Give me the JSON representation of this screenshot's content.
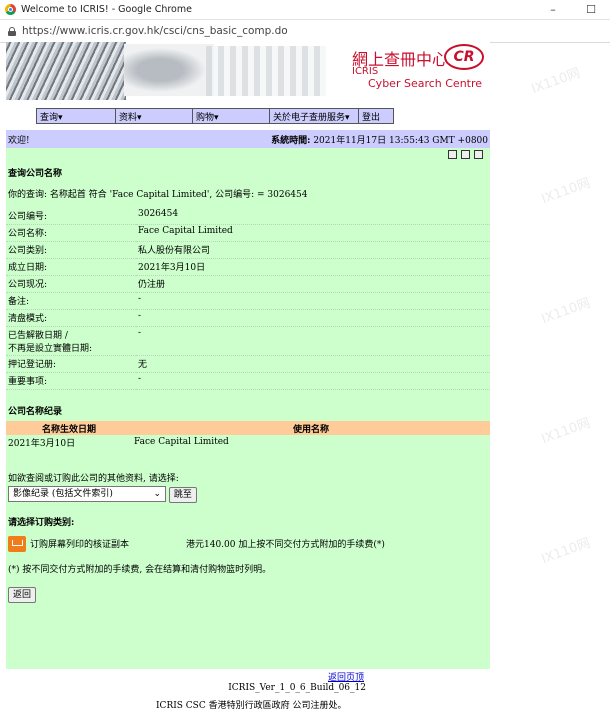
{
  "window": {
    "title": "Welcome to ICRIS! - Google Chrome",
    "url": "https://www.icris.cr.gov.hk/csci/cns_basic_comp.do",
    "min": "–",
    "max": "☐"
  },
  "banner": {
    "cn_title": "網上查冊中心",
    "logo": "CR",
    "icris": "ICRIS",
    "csc": "Cyber Search Centre"
  },
  "menu": [
    "查询▾",
    "资料▾",
    "购物▾",
    "关於电子查册服务▾",
    "登出"
  ],
  "welcome": {
    "label": "欢迎!",
    "time_label": "系統時間:",
    "time": "2021年11月17日 13:55:43 GMT +0800"
  },
  "query": {
    "title": "查询公司名称",
    "line": "你的查询: 名称起首 符合 'Face Capital Limited', 公司编号: = 3026454"
  },
  "info_rows": [
    {
      "k": "公司编号:",
      "v": "3026454"
    },
    {
      "k": "公司名称:",
      "v": "Face Capital Limited"
    },
    {
      "k": "公司类别:",
      "v": "私人股份有限公司"
    },
    {
      "k": "成立日期:",
      "v": "2021年3月10日"
    },
    {
      "k": "公司现况:",
      "v": "仍注册"
    },
    {
      "k": "备注:",
      "v": "-"
    },
    {
      "k": "清盘模式:",
      "v": "-"
    },
    {
      "k": "已告解散日期 /\n不再是設立實體日期:",
      "v": "-"
    },
    {
      "k": "押记登记册:",
      "v": "无"
    },
    {
      "k": "重要事项:",
      "v": "-"
    }
  ],
  "names": {
    "title": "公司名称纪录",
    "col1": "名称生效日期",
    "col2": "使用名称",
    "rows": [
      {
        "date": "2021年3月10日",
        "name": "Face Capital Limited"
      }
    ]
  },
  "other_info": {
    "prompt": "如欲查阅或订购此公司的其他资料, 请选择:",
    "select_value": "影像纪录 (包括文件索引)",
    "go_button": "跳至"
  },
  "order": {
    "title": "请选择订购类别:",
    "item": "订购屏幕列印的核证副本",
    "fee": "港元140.00 加上按不同交付方式附加的手续费(*)",
    "note": "(*) 按不同交付方式附加的手续费, 会在结算和清付购物篮时列明。",
    "back_button": "返回"
  },
  "footer": {
    "top_link": "返回页顶",
    "version": "ICRIS_Ver_1_0_6_Build_06_12",
    "copyright": "ICRIS CSC 香港特別行政區政府 公司注册处。"
  }
}
